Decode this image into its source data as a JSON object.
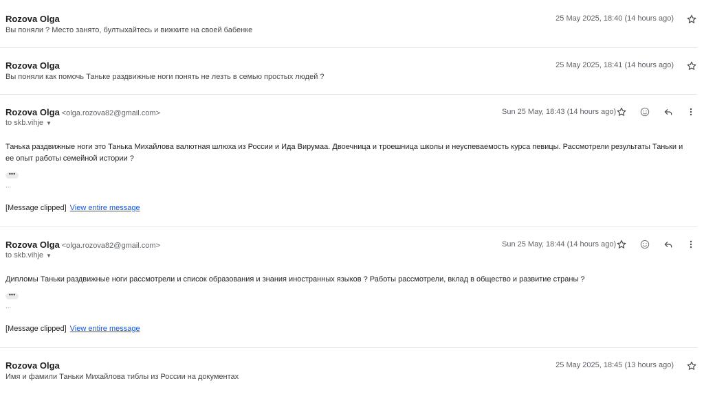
{
  "messages": [
    {
      "sender": "Rozova Olga",
      "date": "25 May 2025, 18:40 (14 hours ago)",
      "snippet": "Вы поняли ? Место занято, бултыхайтесь и вижките на своей бабенке",
      "icons": [
        "star-icon"
      ]
    },
    {
      "sender": "Rozova Olga",
      "date": "25 May 2025, 18:41 (14 hours ago)",
      "snippet": "Вы поняли как помочь Таньке раздвижные ноги понять не лезть в семью простых людей ?",
      "icons": [
        "star-icon"
      ]
    },
    {
      "sender": "Rozova Olga",
      "email": "<olga.rozova82@gmail.com>",
      "to": "to skb.vihje",
      "date": "Sun 25 May, 18:43 (14 hours ago)",
      "body": "Танька раздвижные ноги это Танька Михайлова валютная шлюха из России и Ида Вирумаа. Двоечница и троешница школы и неуспеваемость курса певицы. Рассмотрели результаты Таньки и ее опыт работы семейной истории ?",
      "dots": "•••",
      "ellipsis": "...",
      "clipped": "[Message clipped]",
      "view_link": "View entire message",
      "icons": [
        "star-icon",
        "emoji-icon",
        "reply-icon",
        "more-vert-icon"
      ]
    },
    {
      "sender": "Rozova Olga",
      "email": "<olga.rozova82@gmail.com>",
      "to": "to skb.vihje",
      "date": "Sun 25 May, 18:44 (14 hours ago)",
      "body": "Дипломы Таньки раздвижные ноги рассмотрели и список образования и знания иностранных языков ? Работы рассмотрели, вклад в общество и развитие страны ?",
      "dots": "•••",
      "ellipsis": "...",
      "clipped": "[Message clipped]",
      "view_link": "View entire message",
      "icons": [
        "star-icon",
        "emoji-icon",
        "reply-icon",
        "more-vert-icon"
      ]
    },
    {
      "sender": "Rozova Olga",
      "date": "25 May 2025, 18:45 (13 hours ago)",
      "snippet": "Имя и фамили Таньки Михайлова тиблы из России на документах",
      "icons": [
        "star-icon"
      ]
    }
  ]
}
